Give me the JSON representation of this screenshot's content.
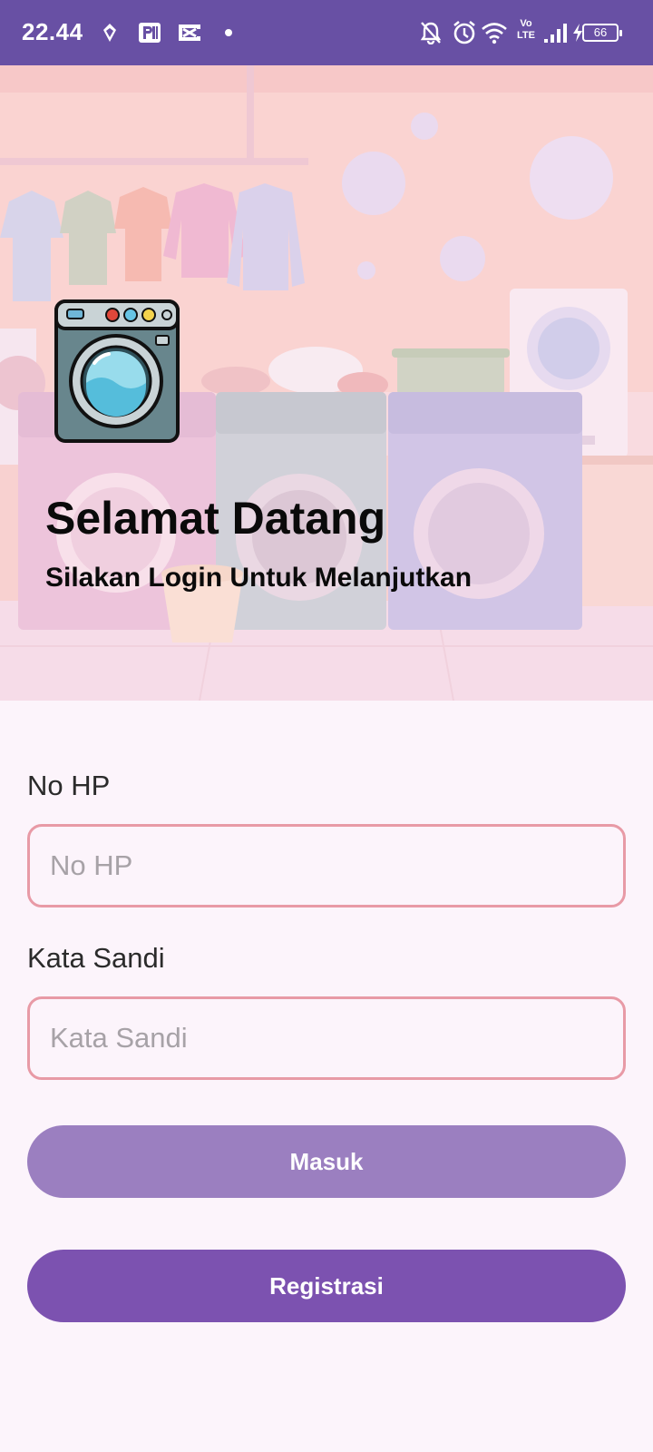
{
  "status_bar": {
    "time": "22.44",
    "battery": "66",
    "volte_line1": "Vo",
    "volte_line2": "LTE",
    "icons": [
      "location-arrow-icon",
      "parking-app-icon",
      "capcut-icon",
      "notification-dot-icon",
      "bell-off-icon",
      "alarm-icon",
      "wifi-icon",
      "volte-icon",
      "signal-icon",
      "charging-icon",
      "battery-icon"
    ]
  },
  "hero": {
    "title": "Selamat Datang",
    "subtitle": "Silakan Login Untuk Melanjutkan",
    "logo_icon": "washing-machine-icon",
    "background": "laundry-room-illustration"
  },
  "form": {
    "phone_label": "No HP",
    "phone_placeholder": "No HP",
    "phone_value": "",
    "password_label": "Kata Sandi",
    "password_placeholder": "Kata Sandi",
    "password_value": ""
  },
  "buttons": {
    "login": "Masuk",
    "register": "Registrasi"
  },
  "colors": {
    "status_bar": "#6850a4",
    "page_background": "#fcf4fb",
    "input_border": "#e89aa6",
    "login_button": "#9b7fc0",
    "register_button": "#7c52b0"
  }
}
